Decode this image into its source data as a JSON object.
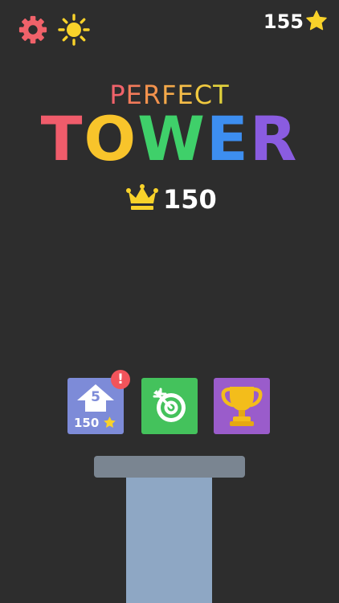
{
  "hud": {
    "star_count": "155",
    "settings_icon": "gear-icon",
    "theme_icon": "sun-icon",
    "currency_icon": "star-icon"
  },
  "title": {
    "line1": "PERFECT",
    "line2": "TOWER"
  },
  "best": {
    "icon": "crown-icon",
    "score": "150"
  },
  "buttons": {
    "upgrade": {
      "level": "5",
      "cost": "150",
      "badge": "!"
    },
    "missions": {
      "icon": "target-icon"
    },
    "leaderboard": {
      "icon": "trophy-icon"
    }
  },
  "colors": {
    "background": "#2d2d2d",
    "gear": "#f0626a",
    "sun": "#f8d22a",
    "star": "#f8d22a",
    "crown": "#f8d22a",
    "upgrade_tile": "#7d8bd8",
    "missions_tile": "#44c25c",
    "trophy_tile": "#9a5ccb",
    "badge": "#f2545b",
    "platform_top": "#7a8591",
    "platform_column": "#8ea7c4"
  }
}
